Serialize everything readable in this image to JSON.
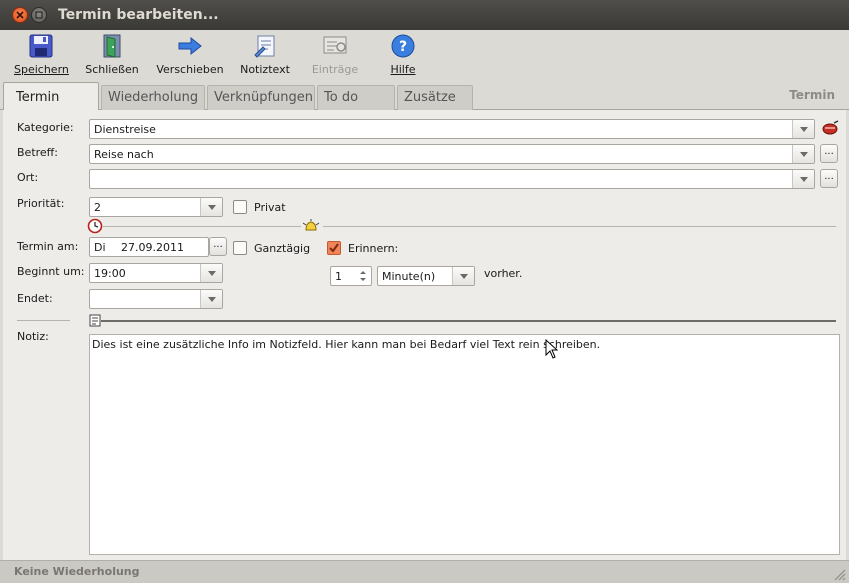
{
  "window": {
    "title": "Termin bearbeiten..."
  },
  "toolbar": {
    "save": "Speichern",
    "close": "Schließen",
    "move": "Verschieben",
    "note": "Notiztext",
    "entries": "Einträge",
    "help": "Hilfe"
  },
  "tabs": [
    {
      "label": "Termin",
      "active": true
    },
    {
      "label": "Wiederholung"
    },
    {
      "label": "Verknüpfungen"
    },
    {
      "label": "To do"
    },
    {
      "label": "Zusätze"
    }
  ],
  "tab_right_label": "Termin",
  "form": {
    "kategorie_label": "Kategorie:",
    "kategorie_value": "Dienstreise",
    "betreff_label": "Betreff:",
    "betreff_value": "Reise nach",
    "ort_label": "Ort:",
    "ort_value": "",
    "prioritaet_label": "Priorität:",
    "prioritaet_value": "2",
    "privat_label": "Privat",
    "termin_label": "Termin am:",
    "termin_day": "Di",
    "termin_date": "27.09.2011",
    "ganztaegig_label": "Ganztägig",
    "erinnern_label": "Erinnern:",
    "beginnt_label": "Beginnt um:",
    "beginnt_value": "19:00",
    "endet_label": "Endet:",
    "endet_value": "",
    "reminder_amount": "1",
    "reminder_unit": "Minute(n)",
    "vorher_label": "vorher.",
    "ellipsis": "...",
    "notiz_label": "Notiz:",
    "notiz_text": "Dies ist eine zusätzliche Info im Notizfeld. Hier kann man bei Bedarf viel Text rein schreiben."
  },
  "status": {
    "text": "Keine Wiederholung"
  },
  "colors": {
    "accent": "#f0845a",
    "titlebar": "#3c3b37"
  }
}
